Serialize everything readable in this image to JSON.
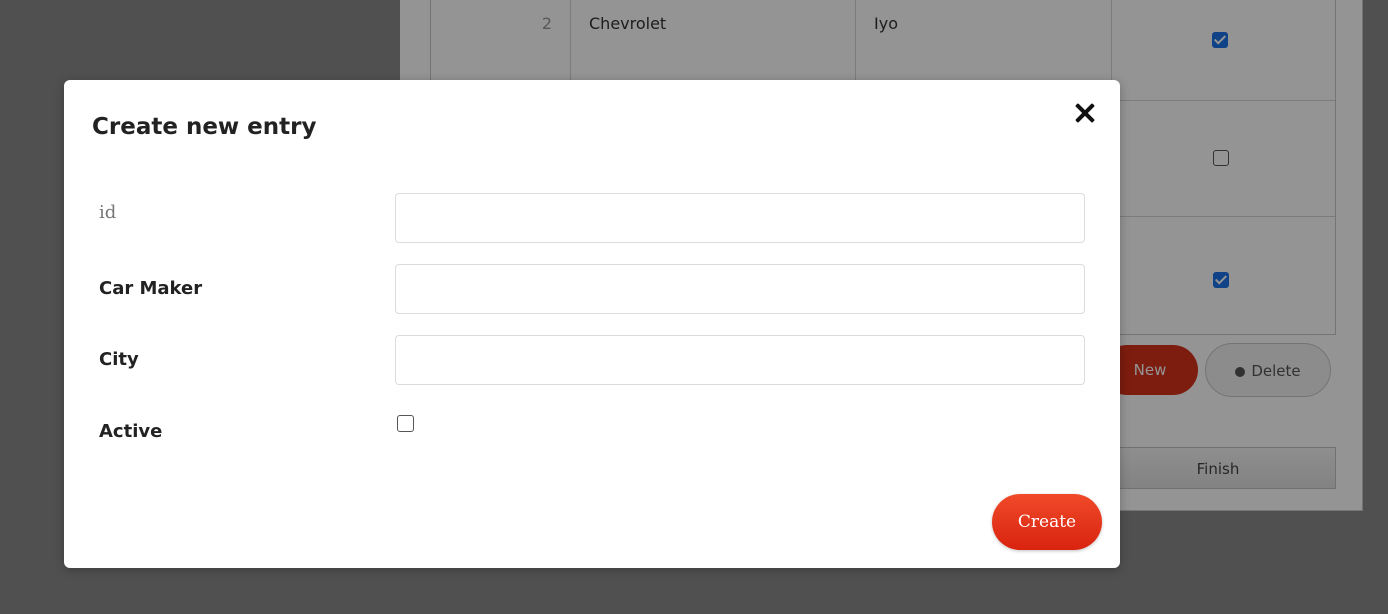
{
  "background": {
    "table_row": {
      "index": "2",
      "maker": "Chevrolet",
      "city": "Iyo"
    },
    "new_label": "New",
    "delete_label": "Delete",
    "finish_label": "Finish"
  },
  "modal": {
    "title": "Create new entry",
    "fields": [
      {
        "label": "id",
        "value": ""
      },
      {
        "label": "Car Maker",
        "value": ""
      },
      {
        "label": "City",
        "value": ""
      }
    ],
    "active_label": "Active",
    "create_label": "Create"
  },
  "colors": {
    "accent": "#e5391d",
    "checkbox_checked": "#1a73e8"
  }
}
